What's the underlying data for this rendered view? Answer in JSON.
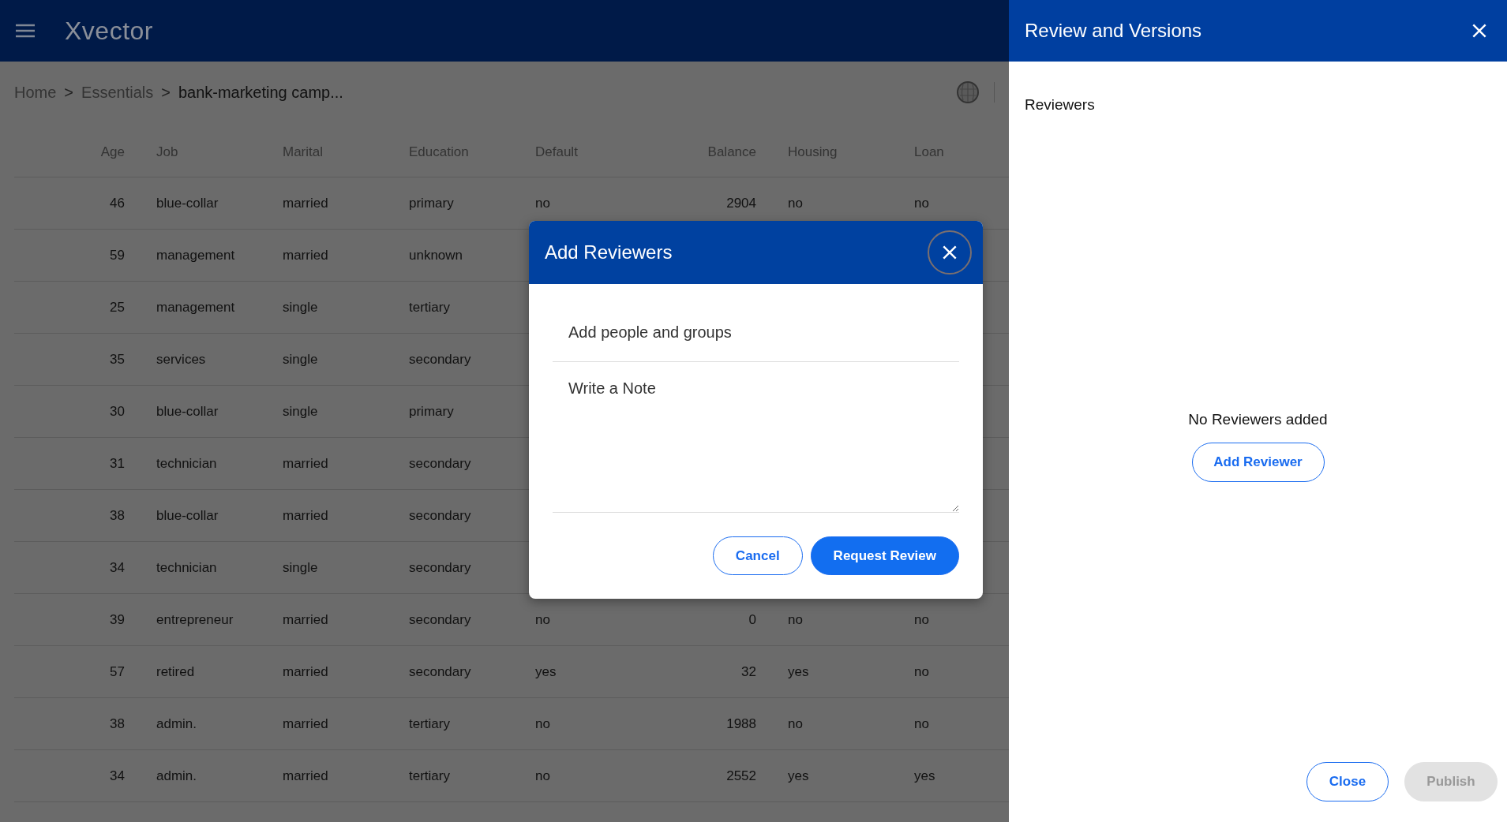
{
  "app": {
    "logo": "Xvector"
  },
  "breadcrumb": [
    "Home",
    "Essentials",
    "bank-marketing camp..."
  ],
  "breadcrumb_separator": ">",
  "table": {
    "columns": [
      "Age",
      "Job",
      "Marital",
      "Education",
      "Default",
      "Balance",
      "Housing",
      "Loan"
    ],
    "rows": [
      {
        "cells": [
          "46",
          "blue-collar",
          "married",
          "primary",
          "no",
          "2904",
          "no",
          "no"
        ]
      },
      {
        "cells": [
          "59",
          "management",
          "married",
          "unknown"
        ]
      },
      {
        "cells": [
          "25",
          "management",
          "single",
          "tertiary"
        ]
      },
      {
        "cells": [
          "35",
          "services",
          "single",
          "secondary"
        ]
      },
      {
        "cells": [
          "30",
          "blue-collar",
          "single",
          "primary"
        ]
      },
      {
        "cells": [
          "31",
          "technician",
          "married",
          "secondary"
        ]
      },
      {
        "cells": [
          "38",
          "blue-collar",
          "married",
          "secondary"
        ]
      },
      {
        "cells": [
          "34",
          "technician",
          "single",
          "secondary"
        ]
      },
      {
        "cells": [
          "39",
          "entrepreneur",
          "married",
          "secondary",
          "no",
          "0",
          "no",
          "no"
        ]
      },
      {
        "cells": [
          "57",
          "retired",
          "married",
          "secondary",
          "yes",
          "32",
          "yes",
          "no"
        ]
      },
      {
        "cells": [
          "38",
          "admin.",
          "married",
          "tertiary",
          "no",
          "1988",
          "no",
          "no"
        ]
      },
      {
        "cells": [
          "34",
          "admin.",
          "married",
          "tertiary",
          "no",
          "2552",
          "yes",
          "yes"
        ]
      }
    ]
  },
  "dialog": {
    "title": "Add Reviewers",
    "people_field": {
      "placeholder": "Add people and groups"
    },
    "note_field": {
      "placeholder": "Write a Note"
    },
    "buttons": [
      {
        "label": "Cancel",
        "kind": "outline"
      },
      {
        "label": "Request Review",
        "kind": "primary"
      }
    ]
  },
  "side_panel": {
    "title": "Review and Versions",
    "section": "Reviewers",
    "empty_message": "No Reviewers added",
    "add_button": "Add Reviewer",
    "buttons": [
      {
        "label": "Close",
        "kind": "outline",
        "disabled": false
      },
      {
        "label": "Publish",
        "kind": "primary",
        "disabled": true
      }
    ]
  }
}
